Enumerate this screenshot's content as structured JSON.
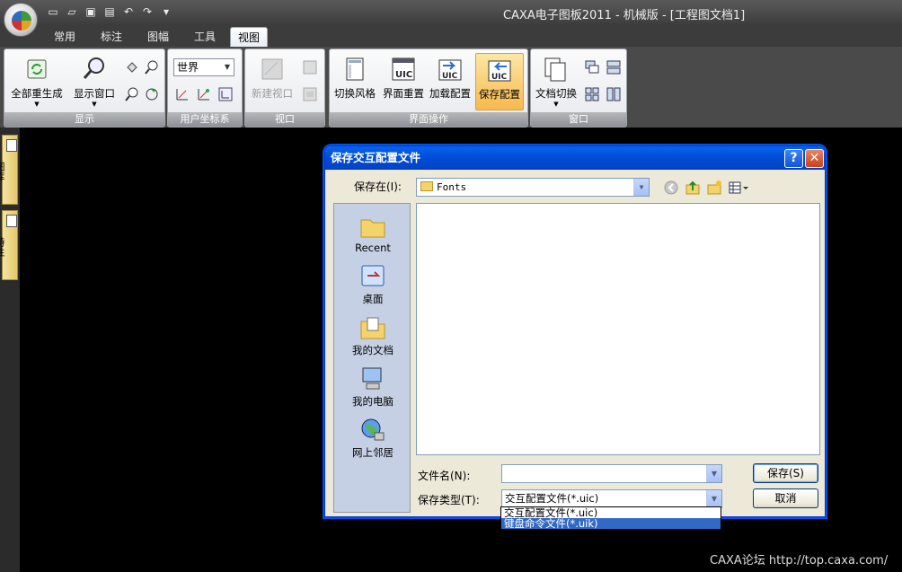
{
  "window": {
    "title": "CAXA电子图板2011 - 机械版 - [工程图文档1]"
  },
  "ribbon": {
    "tabs": [
      "常用",
      "标注",
      "图幅",
      "工具",
      "视图"
    ],
    "active_tab": "视图",
    "groups": {
      "display": {
        "title": "显示",
        "regen_all": "全部重生成",
        "display_window": "显示窗口"
      },
      "ucs": {
        "title": "用户坐标系",
        "combo_value": "世界"
      },
      "viewport": {
        "title": "视口",
        "new_viewport": "新建视口"
      },
      "ui_ops": {
        "title": "界面操作",
        "switch_style": "切换风格",
        "reset_ui": "界面重置",
        "load_config": "加载配置",
        "save_config": "保存配置"
      },
      "window": {
        "title": "窗口",
        "doc_switch": "文档切换"
      }
    }
  },
  "left_tabs": [
    "图库",
    "特性"
  ],
  "dialog": {
    "title": "保存交互配置文件",
    "save_in_label": "保存在(I):",
    "save_in_value": "Fonts",
    "places": [
      "Recent",
      "桌面",
      "我的文档",
      "我的电脑",
      "网上邻居"
    ],
    "filename_label": "文件名(N):",
    "filename_value": "",
    "filetype_label": "保存类型(T):",
    "filetype_value": "交互配置文件(*.uic)",
    "filetype_options": [
      "交互配置文件(*.uic)",
      "键盘命令文件(*.uik)"
    ],
    "highlighted_option": 1,
    "save_button": "保存(S)",
    "cancel_button": "取消"
  },
  "watermark": "CAXA论坛 http://top.caxa.com/"
}
